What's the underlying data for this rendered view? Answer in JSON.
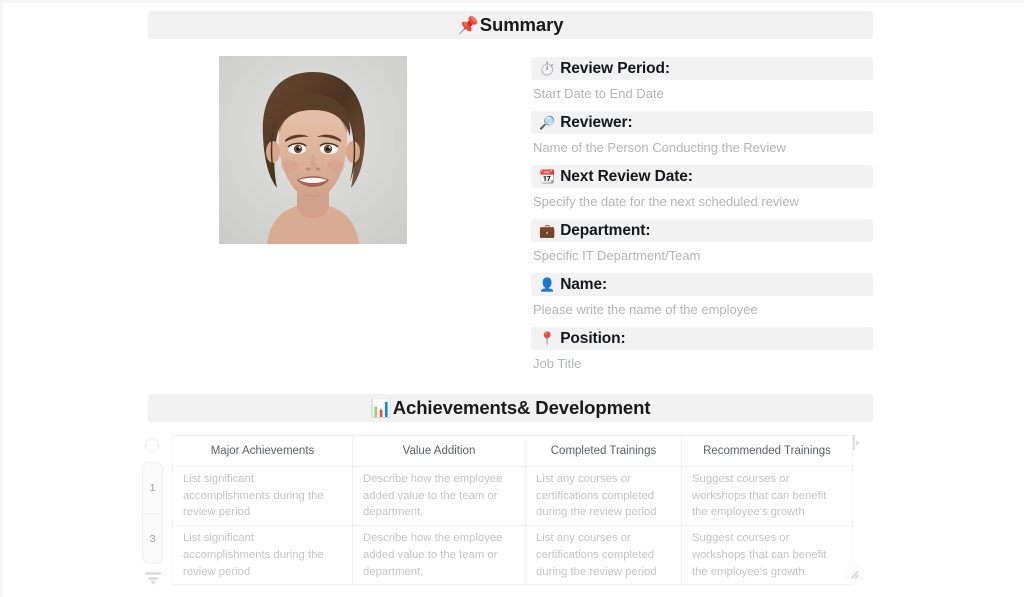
{
  "sections": {
    "summary": {
      "icon": "pushpin-icon",
      "glyph": "📌",
      "title": "Summary"
    },
    "achievements": {
      "icon": "bar-chart-icon",
      "glyph": "📊",
      "title": "Achievements& Development"
    }
  },
  "photo": {
    "alt": "Employee portrait photo",
    "background": "#d7d7d5"
  },
  "fields": [
    {
      "icon": "stopwatch-icon",
      "glyph": "⏱️",
      "label": "Review Period:",
      "value": "Start Date to End Date"
    },
    {
      "icon": "magnifier-icon",
      "glyph": "🔎",
      "label": "Reviewer:",
      "value": "Name of the Person Conducting the Review"
    },
    {
      "icon": "calendar-icon",
      "glyph": "📆",
      "label": "Next Review Date:",
      "value": "Specify the date for the next scheduled review"
    },
    {
      "icon": "briefcase-icon",
      "glyph": "💼",
      "label": "Department:",
      "value": "Specific IT Department/Team"
    },
    {
      "icon": "person-icon",
      "glyph": "👤",
      "label": "Name:",
      "value": "Please write the name of the employee"
    },
    {
      "icon": "map-pin-icon",
      "glyph": "📍",
      "label": "Position:",
      "value": "Job Title"
    }
  ],
  "table": {
    "columns": [
      "Major Achievements",
      "Value Addition",
      "Completed Trainings",
      "Recommended Trainings"
    ],
    "row_numbers": [
      "1",
      "3"
    ],
    "rows": [
      [
        "List significant accomplishments during the review period",
        "Describe how the employee added value to the team or department.",
        "List any courses or certifications completed during the review period",
        "Suggest courses or workshops that can benefit the employee's growth"
      ],
      [
        "List significant accomplishments during the review period",
        "Describe how the employee added value to the team or department.",
        "List any courses or certifications completed during the review period",
        "Suggest courses or workshops that can benefit the employee's growth"
      ]
    ]
  },
  "colors": {
    "section_bar": "#f1f1f1",
    "field_label_bar": "#f2f2f2",
    "placeholder_text": "#b2b4b6",
    "header_text": "#5c6063",
    "grid_line": "#f0f1f2"
  }
}
